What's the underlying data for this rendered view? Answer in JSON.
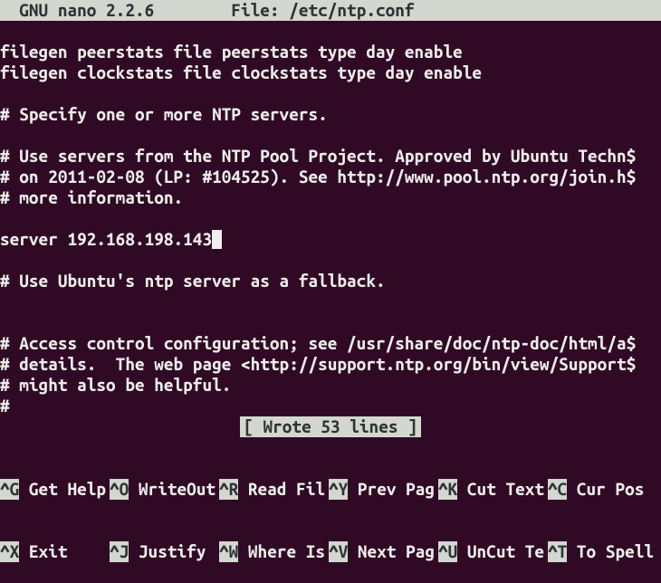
{
  "titlebar": {
    "app": "  GNU nano 2.2.6",
    "file_label": "File: /etc/ntp.conf"
  },
  "content": {
    "lines": [
      "",
      "filegen peerstats file peerstats type day enable",
      "filegen clockstats file clockstats type day enable",
      "",
      "# Specify one or more NTP servers.",
      "",
      "# Use servers from the NTP Pool Project. Approved by Ubuntu Techn",
      "# on 2011-02-08 (LP: #104525). See http://www.pool.ntp.org/join.h",
      "# more information.",
      "",
      "server 192.168.198.143",
      "",
      "# Use Ubuntu's ntp server as a fallback.",
      "",
      "",
      "# Access control configuration; see /usr/share/doc/ntp-doc/html/a",
      "# details.  The web page <http://support.ntp.org/bin/view/Support",
      "# might also be helpful.",
      "#"
    ],
    "trunc_indices": [
      6,
      7,
      15,
      16
    ],
    "cursor_line_index": 10,
    "trunc_char": "$"
  },
  "status": {
    "message": "[ Wrote 53 lines ]"
  },
  "shortcuts": {
    "row1": [
      {
        "key": "^G",
        "label": " Get Help"
      },
      {
        "key": "^O",
        "label": " WriteOut"
      },
      {
        "key": "^R",
        "label": " Read Fil"
      },
      {
        "key": "^Y",
        "label": " Prev Pag"
      },
      {
        "key": "^K",
        "label": " Cut Text"
      },
      {
        "key": "^C",
        "label": " Cur Pos"
      }
    ],
    "row2": [
      {
        "key": "^X",
        "label": " Exit"
      },
      {
        "key": "^J",
        "label": " Justify"
      },
      {
        "key": "^W",
        "label": " Where Is"
      },
      {
        "key": "^V",
        "label": " Next Pag"
      },
      {
        "key": "^U",
        "label": " UnCut Te"
      },
      {
        "key": "^T",
        "label": " To Spell"
      }
    ]
  }
}
